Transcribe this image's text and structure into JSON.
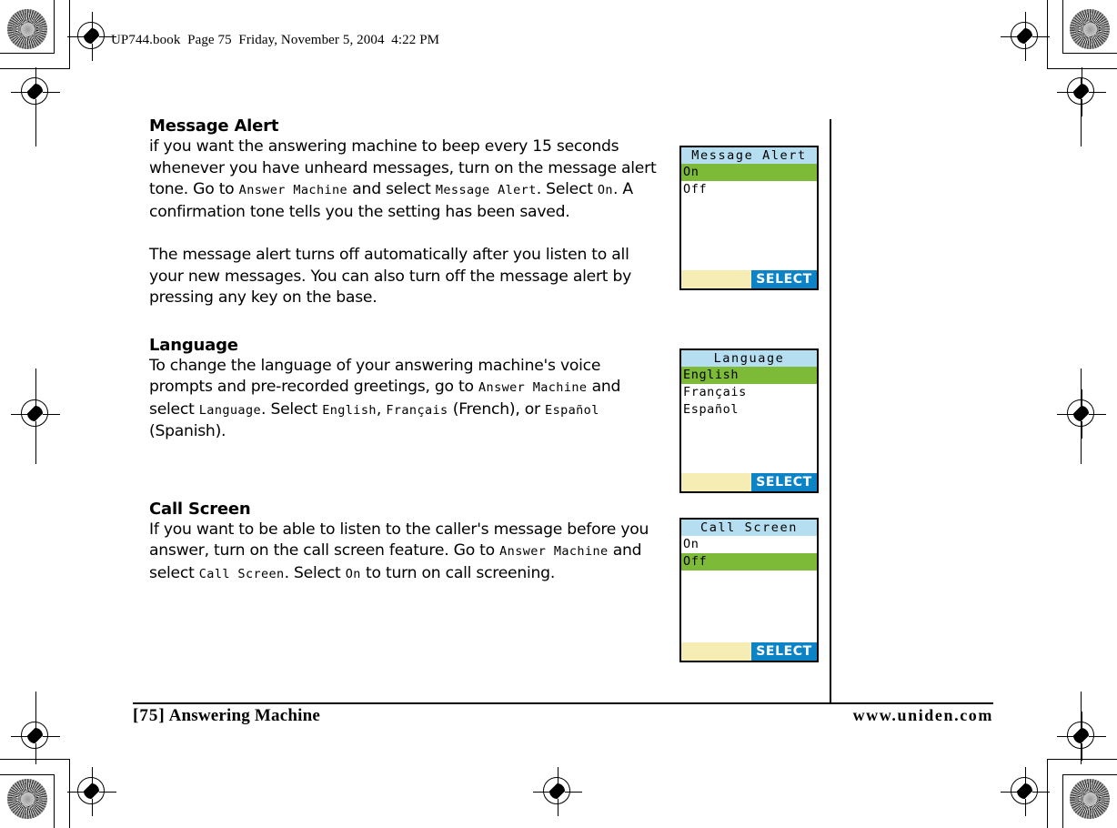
{
  "header": {
    "note": "UP744.book  Page 75  Friday, November 5, 2004  4:22 PM"
  },
  "sections": [
    {
      "title": "Message Alert",
      "paragraphs": [
        [
          {
            "t": "plain",
            "v": "if you want the answering machine to beep every 15 seconds whenever you have unheard messages, turn on the message alert tone. Go to "
          },
          {
            "t": "lcd",
            "v": "Answer Machine"
          },
          {
            "t": "plain",
            "v": " and select "
          },
          {
            "t": "lcd",
            "v": "Message Alert"
          },
          {
            "t": "plain",
            "v": ". Select "
          },
          {
            "t": "lcd",
            "v": "On"
          },
          {
            "t": "plain",
            "v": ". A confirmation tone tells you the setting has been saved."
          }
        ],
        [
          {
            "t": "plain",
            "v": "The message alert turns off automatically after you listen to all your new messages. You can also turn off the message alert by pressing any key on the base."
          }
        ]
      ]
    },
    {
      "title": "Language",
      "paragraphs": [
        [
          {
            "t": "plain",
            "v": "To change the language of your answering machine's voice prompts and pre-recorded greetings, go to "
          },
          {
            "t": "lcd",
            "v": "Answer Machine"
          },
          {
            "t": "plain",
            "v": " and select "
          },
          {
            "t": "lcd",
            "v": "Language"
          },
          {
            "t": "plain",
            "v": ". Select "
          },
          {
            "t": "lcd",
            "v": "English"
          },
          {
            "t": "plain",
            "v": ", "
          },
          {
            "t": "lcd",
            "v": "Français"
          },
          {
            "t": "plain",
            "v": " (French), or "
          },
          {
            "t": "lcd",
            "v": "Español"
          },
          {
            "t": "plain",
            "v": " (Spanish)."
          }
        ]
      ]
    },
    {
      "title": "Call Screen",
      "paragraphs": [
        [
          {
            "t": "plain",
            "v": "If you want to be able to listen to the caller's message before you answer, turn on the call screen feature. Go to "
          },
          {
            "t": "lcd",
            "v": "Answer Machine"
          },
          {
            "t": "plain",
            "v": " and select "
          },
          {
            "t": "lcd",
            "v": "Call Screen"
          },
          {
            "t": "plain",
            "v": ". Select "
          },
          {
            "t": "lcd",
            "v": "On"
          },
          {
            "t": "plain",
            "v": " to turn on call screening."
          }
        ]
      ]
    }
  ],
  "screens": [
    {
      "name": "message-alert",
      "title": "Message Alert",
      "items": [
        {
          "label": "On",
          "selected": true
        },
        {
          "label": "Off",
          "selected": false
        }
      ],
      "softkey": "SELECT"
    },
    {
      "name": "language",
      "title": "Language",
      "items": [
        {
          "label": "English",
          "selected": true
        },
        {
          "label": "Français",
          "selected": false
        },
        {
          "label": "Español",
          "selected": false
        }
      ],
      "softkey": "SELECT"
    },
    {
      "name": "call-screen",
      "title": "Call Screen",
      "items": [
        {
          "label": "On",
          "selected": false
        },
        {
          "label": "Off",
          "selected": true
        }
      ],
      "softkey": "SELECT"
    }
  ],
  "footer": {
    "page_number": "[75]",
    "chapter": "Answering Machine",
    "website": "www.uniden.com"
  },
  "colors": {
    "lcd_title_bar": "#b5dff0",
    "lcd_highlight": "#7dba38",
    "lcd_softkey_bar": "#f6edb4",
    "lcd_softkey_button": "#0b83c6",
    "ink": "#000000"
  }
}
